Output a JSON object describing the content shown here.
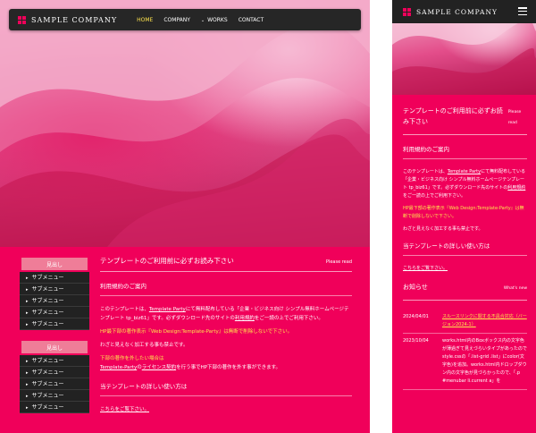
{
  "brand": {
    "name": "SAMPLE COMPANY"
  },
  "nav": {
    "items": [
      "HOME",
      "COMPANY",
      "WORKS",
      "CONTACT"
    ],
    "current": "HOME",
    "dropdown_index": 2
  },
  "colors": {
    "accent": "#f0005a",
    "nav_bg": "#262626",
    "highlight": "#ffe44d",
    "sidebar_head": "#ef7d98"
  },
  "icons": {
    "logo": "logo-grid-icon",
    "dropdown": "chevron-down-icon",
    "menu": "hamburger-icon",
    "bullet": "triangle-right-icon"
  },
  "sidebar": [
    {
      "head": "見出し",
      "items": [
        "サブメニュー",
        "サブメニュー",
        "サブメニュー",
        "サブメニュー",
        "サブメニュー"
      ]
    },
    {
      "head": "見出し",
      "items": [
        "サブメニュー",
        "サブメニュー",
        "サブメニュー",
        "サブメニュー",
        "サブメニュー"
      ]
    }
  ],
  "main": {
    "title": "テンプレートのご利用前に必ずお読み下さい",
    "title_en": "Please read",
    "guide_heading": "利用規約のご案内",
    "p1_a": "このテンプレートは、",
    "p1_link1": "Template Party",
    "p1_b": "にて無料配布している「企業・ビジネス向け シンプル無料ホームページテンプレート tp_biz61」です。必ずダウンロード先のサイトの",
    "p1_link2": "利用規約",
    "p1_c": "をご一読の上でご利用下さい。",
    "p2": "HP最下部の著作表示『Web Design:Template-Party』は無断で削除しないで下さい。",
    "p3": "わざと見えなく加工する事も禁止です。",
    "p4": "下部の著作を外したい場合は",
    "p5_a": "Template-Party",
    "p5_b": "の",
    "p5_link": "ライセンス契約",
    "p5_c": "を行う事でHP下部の著作を外す事ができます。",
    "usage_heading": "当テンプレートの詳しい使い方は",
    "usage_link": "こちらをご覧下さい。"
  },
  "mobile": {
    "title": "テンプレートのご利用前に必ずお読み下さい",
    "title_en": "Please read",
    "guide_heading": "利用規約のご案内",
    "p1_a": "このテンプレートは、",
    "p1_link1": "Template Party",
    "p1_b": "にて無料配布している「企業・ビジネス向け シンプル無料ホームページテンプレート tp_biz61」です。必ずダウンロード先のサイトの",
    "p1_link2": "利用規約",
    "p1_c": "をご一読の上でご利用下さい。",
    "p2": "HP最下部の著作表示『Web Design:Template-Party』は無断で削除しないで下さい。",
    "p3": "わざと見えなく加工する事も禁止です。",
    "usage_heading": "当テンプレートの詳しい使い方は",
    "usage_link": "こちらをご覧下さい。",
    "news_heading": "お知らせ",
    "news_heading_en": "What's new",
    "news": [
      {
        "date": "2024/04/01",
        "text": "スルースリンクに関する不具合対応（バージョン2024-1）"
      },
      {
        "date": "2023/10/04",
        "text": "works.html内のBoxボックス内の文字色が薄過ぎて見えづらいタイプがあったのでstyle.cssの「.list-grid .list」にcolor(文字色)を追加。works.html内ドロップダウン内の文字色が見づらかったので、「.p #menubar li.current a」を"
      }
    ]
  }
}
